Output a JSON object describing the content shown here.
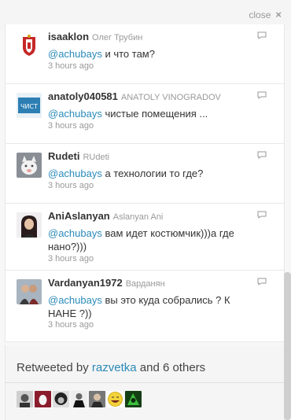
{
  "header": {
    "close_label": "close",
    "close_icon": "×"
  },
  "tweets": [
    {
      "username": "isaaklon",
      "realname": "Олег Трубин",
      "mention": "@achubays",
      "text": " и что там?",
      "time": "3 hours ago",
      "avatar": "coat-of-arms-avatar"
    },
    {
      "username": "anatoly040581",
      "realname": "ANATOLY VINOGRADOV",
      "mention": "@achubays",
      "text": " чистые помещения ...",
      "time": "3 hours ago",
      "avatar": "blue-logo-avatar"
    },
    {
      "username": "Rudeti",
      "realname": "RUdeti",
      "mention": "@achubays",
      "text": " а технологии то где?",
      "time": "3 hours ago",
      "avatar": "white-cat-avatar"
    },
    {
      "username": "AniAslanyan",
      "realname": "Aslanyan Ani",
      "mention": "@achubays",
      "text": " вам идет костюмчик)))а где нано?)))",
      "time": "3 hours ago",
      "avatar": "woman-portrait-avatar"
    },
    {
      "username": "Vardanyan1972",
      "realname": "Варданян",
      "mention": "@achubays",
      "text": " вы это куда собрались ? К НАНЕ ?))",
      "time": "3 hours ago",
      "avatar": "couple-photo-avatar"
    }
  ],
  "retweets": {
    "prefix": "Retweeted by ",
    "user": "razvetka",
    "suffix": " and 6 others",
    "avatars": [
      "face-avatar-1",
      "red-egg-avatar",
      "curly-hair-avatar",
      "suit-avatar",
      "man-avatar",
      "laughing-emoji-avatar",
      "green-icon-avatar"
    ]
  },
  "colors": {
    "link": "#2a8ab8",
    "muted": "#999999"
  }
}
